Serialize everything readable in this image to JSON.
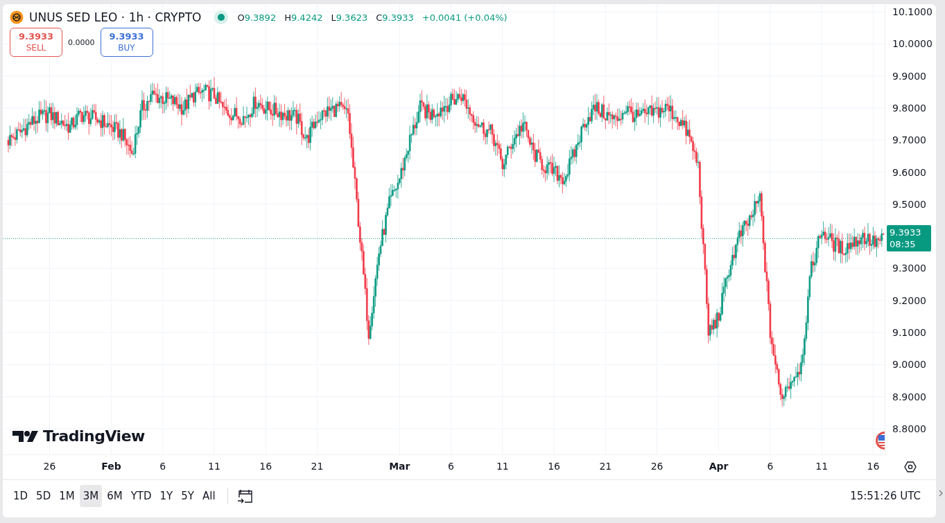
{
  "legend": {
    "title": "UNUS SED LEO · 1h · CRYPTO",
    "ohlc": [
      {
        "label": "O",
        "value": "9.3892"
      },
      {
        "label": "H",
        "value": "9.4242"
      },
      {
        "label": "L",
        "value": "9.3623"
      },
      {
        "label": "C",
        "value": "9.3933"
      }
    ],
    "change": "+0.0041 (+0.04%)"
  },
  "trade": {
    "sell": {
      "price": "9.3933",
      "label": "SELL"
    },
    "spread": "0.0000",
    "buy": {
      "price": "9.3933",
      "label": "BUY"
    }
  },
  "chart": {
    "kind": "picture",
    "y_axis_labels": [
      "10.1000",
      "10.0000",
      "9.9000",
      "9.8000",
      "9.7000",
      "9.6000",
      "9.5000",
      "9.3000",
      "9.2000",
      "9.1000",
      "9.0000",
      "8.9000",
      "8.8000"
    ],
    "x_axis_labels": [
      {
        "label": "26",
        "kind": "day"
      },
      {
        "label": "Feb",
        "kind": "month"
      },
      {
        "label": "6",
        "kind": "day"
      },
      {
        "label": "11",
        "kind": "day"
      },
      {
        "label": "16",
        "kind": "day"
      },
      {
        "label": "21",
        "kind": "day"
      },
      {
        "label": "Mar",
        "kind": "month"
      },
      {
        "label": "6",
        "kind": "day"
      },
      {
        "label": "11",
        "kind": "day"
      },
      {
        "label": "16",
        "kind": "day"
      },
      {
        "label": "21",
        "kind": "day"
      },
      {
        "label": "26",
        "kind": "day"
      },
      {
        "label": "Apr",
        "kind": "month"
      },
      {
        "label": "6",
        "kind": "day"
      },
      {
        "label": "11",
        "kind": "day"
      },
      {
        "label": "16",
        "kind": "day"
      }
    ],
    "last_price": {
      "price": "9.3933",
      "countdown": "08:35"
    },
    "logo": "TradingView"
  },
  "range_buttons": [
    {
      "label": "1D",
      "selected": false
    },
    {
      "label": "5D",
      "selected": false
    },
    {
      "label": "1M",
      "selected": false
    },
    {
      "label": "3M",
      "selected": true
    },
    {
      "label": "6M",
      "selected": false
    },
    {
      "label": "YTD",
      "selected": false
    },
    {
      "label": "1Y",
      "selected": false
    },
    {
      "label": "5Y",
      "selected": false
    },
    {
      "label": "All",
      "selected": false
    }
  ],
  "clock": "15:51:26 UTC"
}
